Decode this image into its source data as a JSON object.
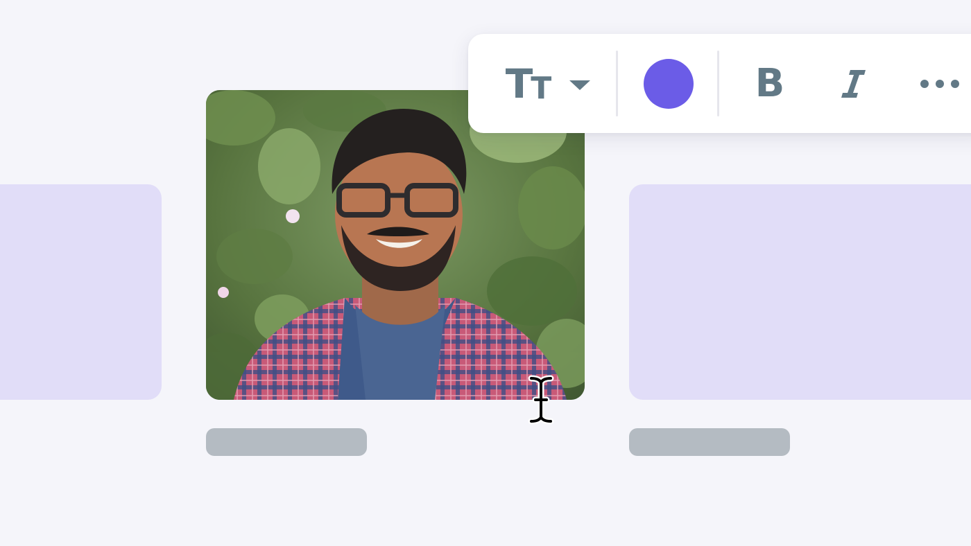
{
  "toolbar": {
    "text_size_icon": "text-size-icon",
    "dropdown_icon": "chevron-down-icon",
    "color_value": "#6b5ce7",
    "bold_label": "B",
    "italic_icon": "italic-icon",
    "more_icon": "more-horizontal-icon",
    "glyph_big": "T",
    "glyph_small": "T"
  },
  "cards": [
    {
      "kind": "placeholder"
    },
    {
      "kind": "photo",
      "subject": "portrait-photo"
    },
    {
      "kind": "placeholder"
    }
  ],
  "colors": {
    "background": "#f5f5fa",
    "placeholder": "#e1ddf8",
    "caption_pill": "#b4bbc2",
    "icon": "#627986",
    "accent": "#6b5ce7"
  },
  "cursor": "text-cursor"
}
